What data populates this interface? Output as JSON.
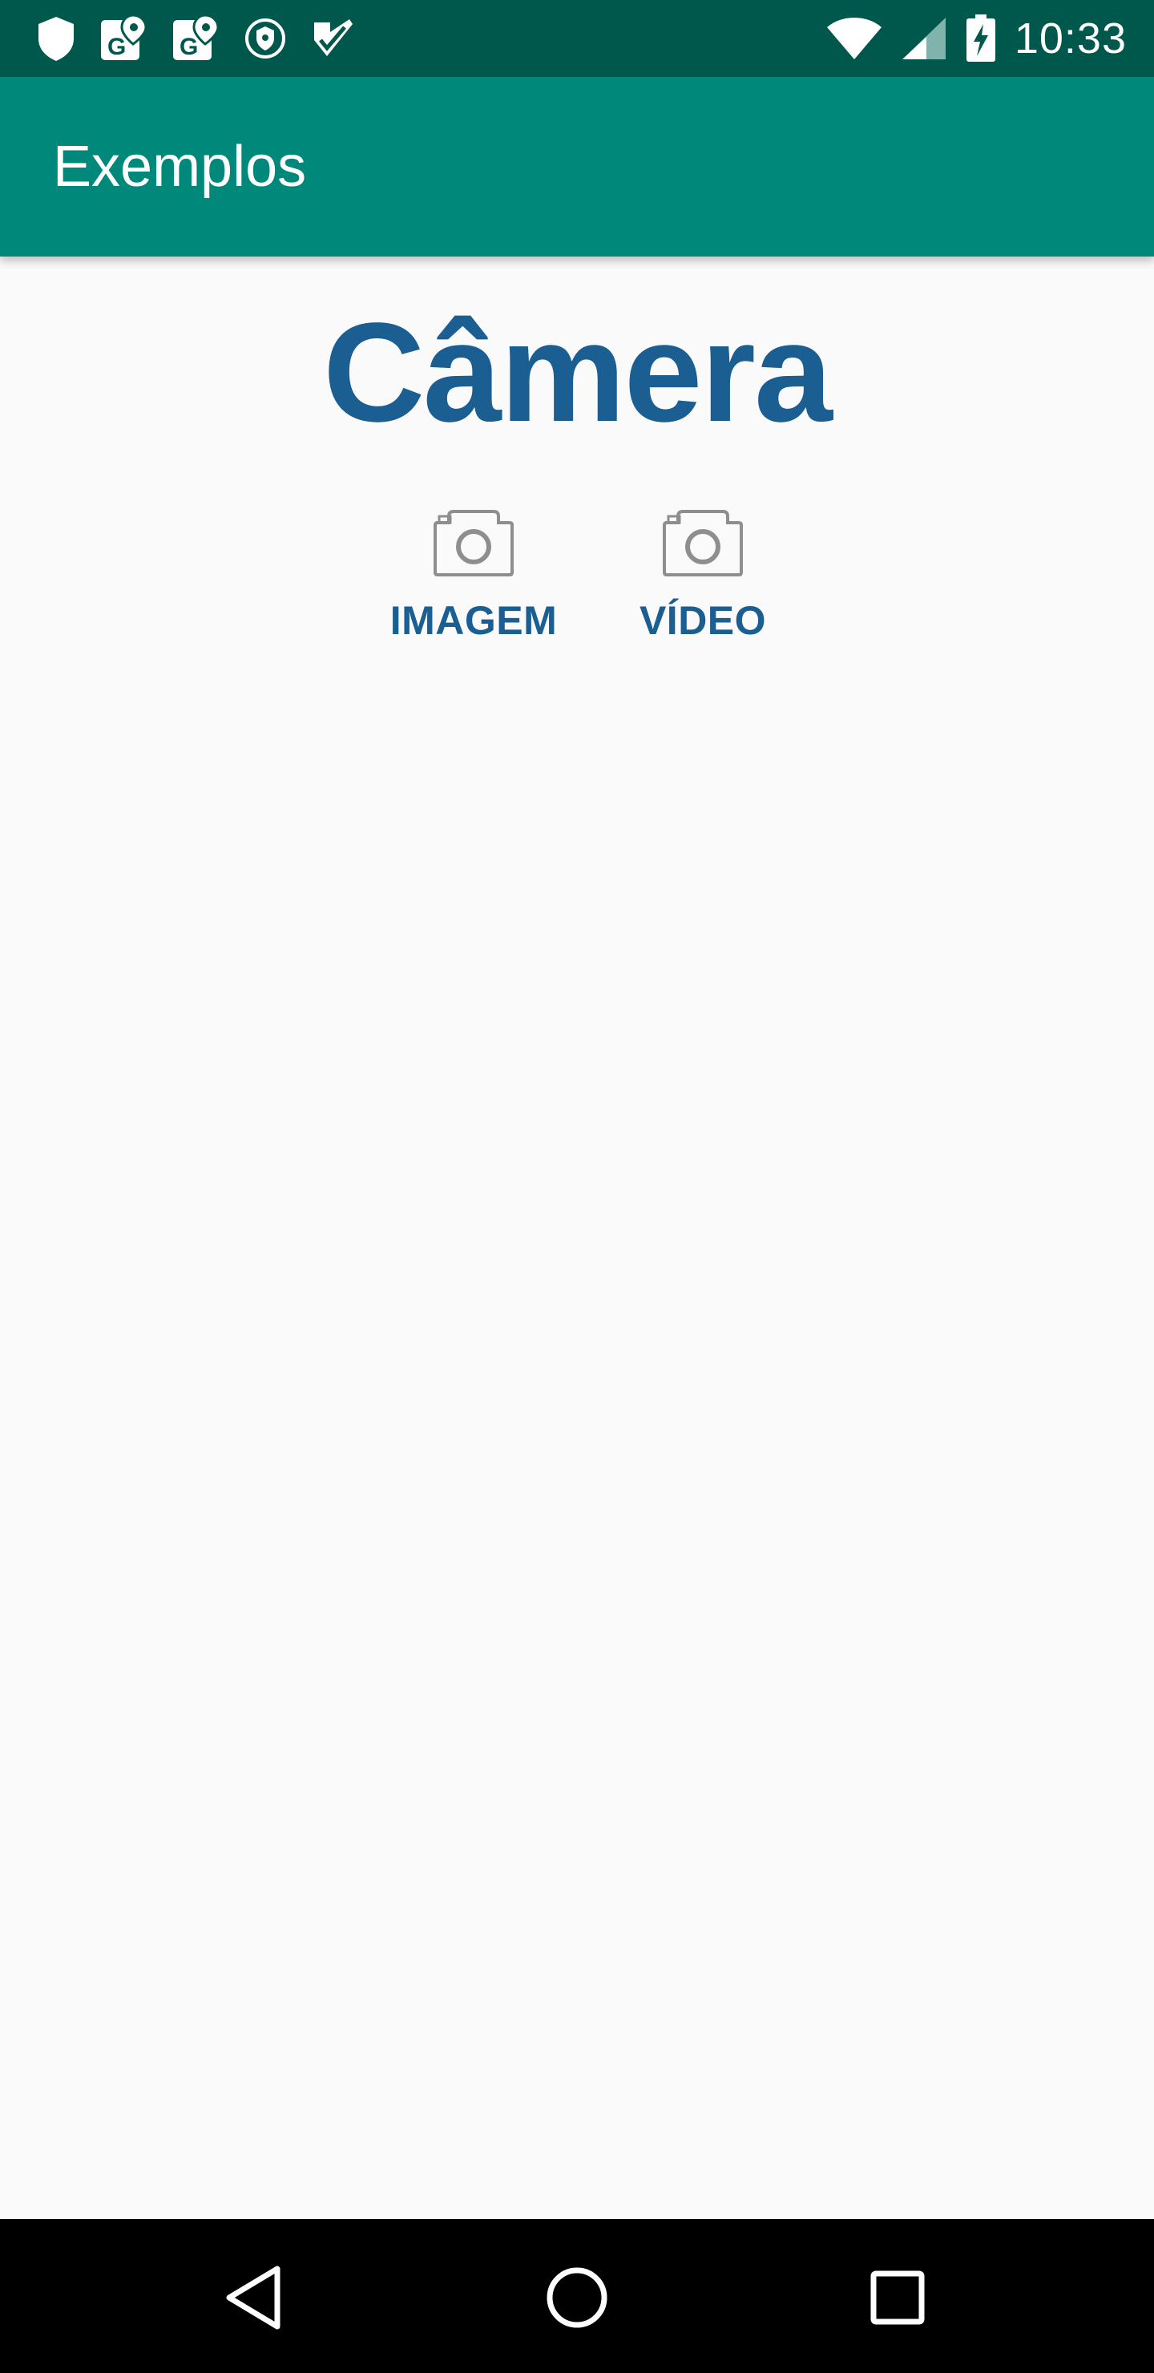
{
  "status_bar": {
    "time": "10:33",
    "left_icons": [
      "shield-icon",
      "maps-g-icon",
      "maps-g-icon",
      "vpn-shield-icon",
      "check-icon"
    ],
    "right_icons": [
      "wifi-icon",
      "cellular-signal-icon",
      "battery-charging-icon"
    ],
    "background": "#00574b"
  },
  "app_bar": {
    "title": "Exemplos",
    "background": "#00897b"
  },
  "main": {
    "heading": "Câmera",
    "heading_color": "#1b5e91",
    "actions": [
      {
        "label": "IMAGEM",
        "icon": "camera-icon"
      },
      {
        "label": "VÍDEO",
        "icon": "camera-icon"
      }
    ]
  },
  "nav_bar": {
    "buttons": [
      "back-icon",
      "home-icon",
      "recents-icon"
    ]
  }
}
